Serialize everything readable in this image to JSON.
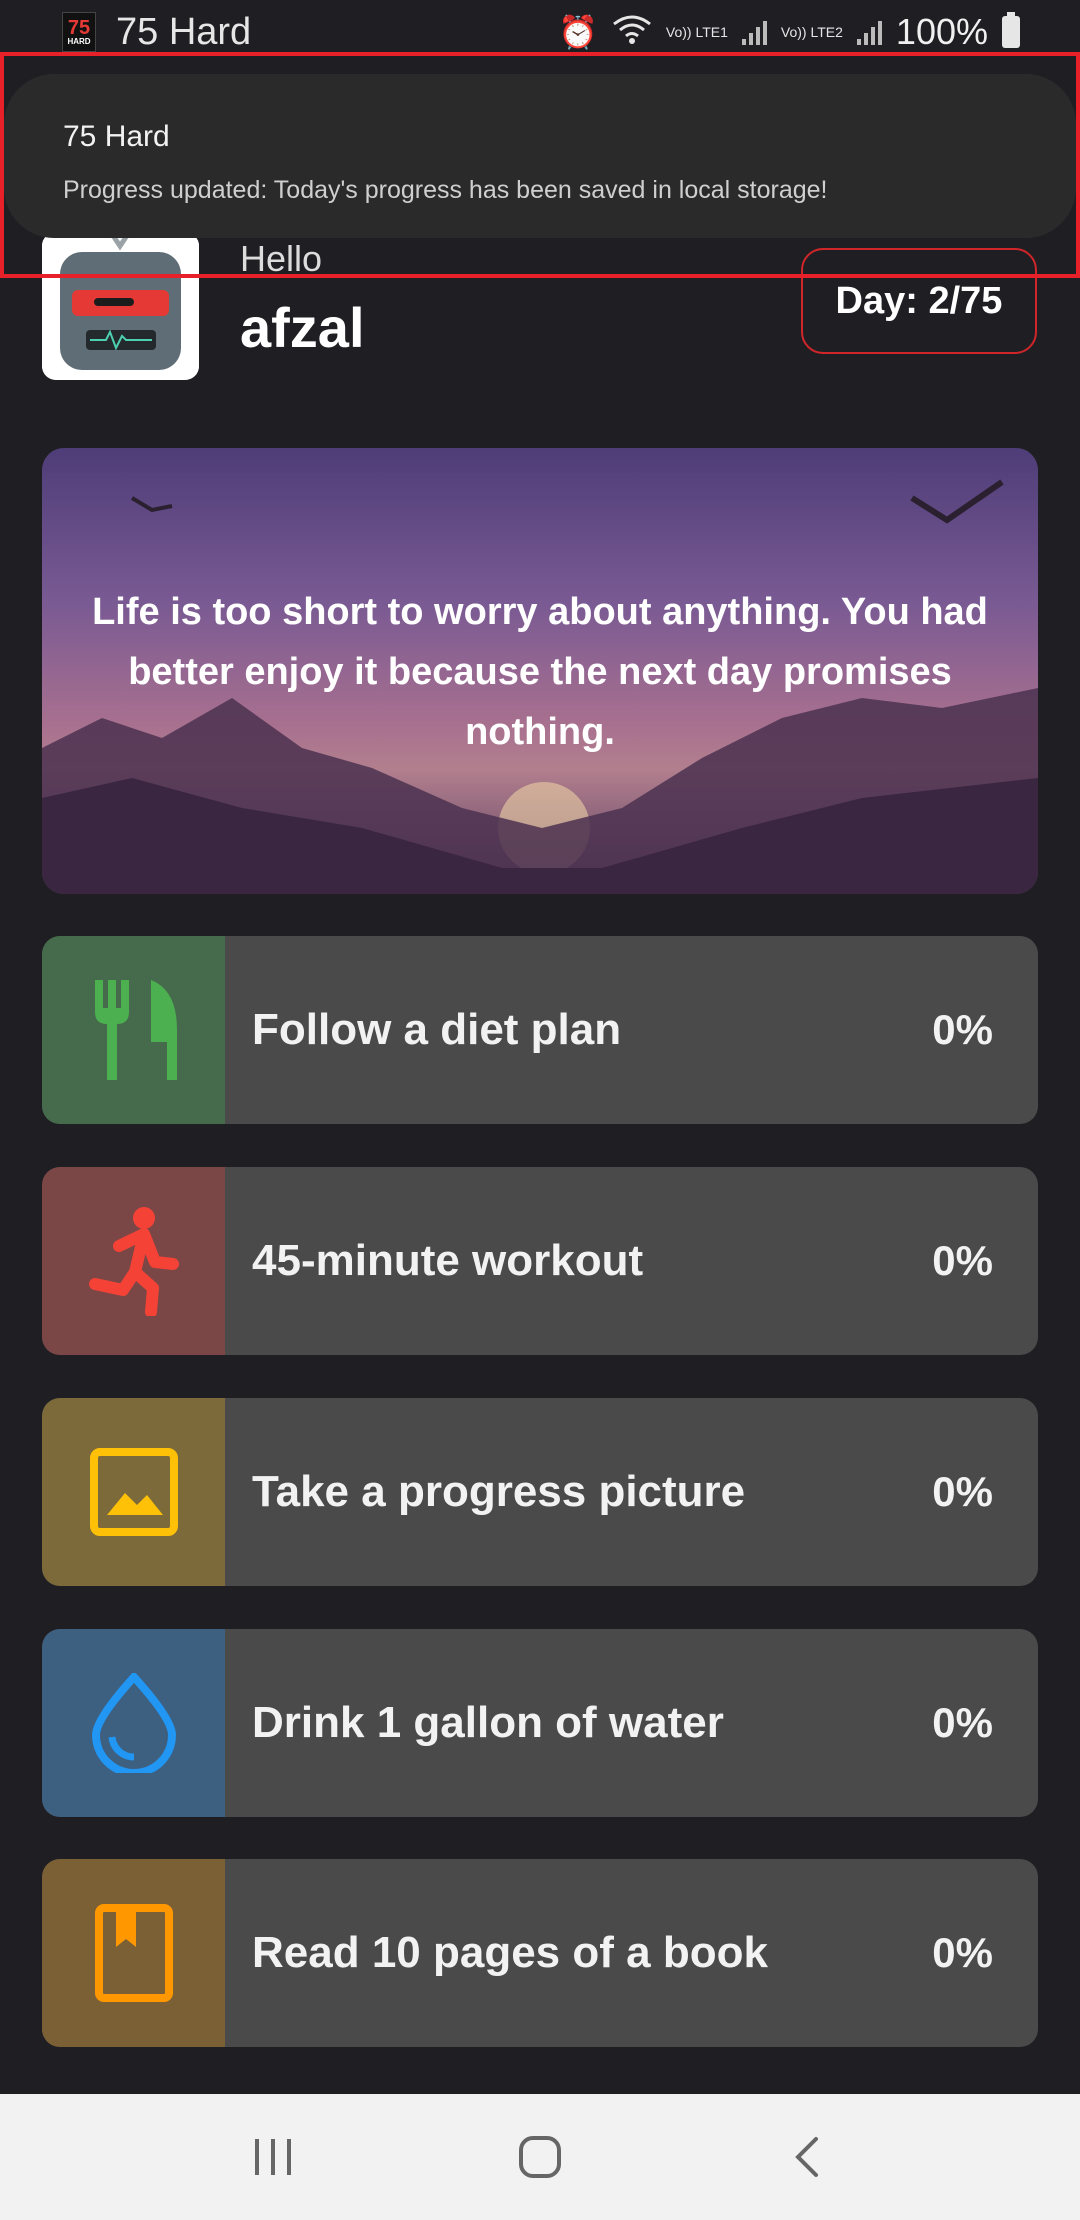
{
  "status_bar": {
    "app_title": "75 Hard",
    "icon_text": "75",
    "icon_sub": "HARD",
    "net1": "Vo)) LTE1",
    "net2": "Vo)) LTE2",
    "battery": "100%"
  },
  "toast": {
    "title": "75 Hard",
    "message": "Progress updated: Today's progress has been saved in local storage!"
  },
  "header": {
    "greeting": "Hello",
    "username": "afzal",
    "day": "Day: 2/75"
  },
  "quote": {
    "text": "Life is too short to worry about anything. You had better enjoy it because the next day promises nothing."
  },
  "tasks": [
    {
      "label": "Follow a diet plan",
      "percent": "0%",
      "icon": "fork-knife-icon",
      "color": "#4cb050",
      "bg": "#466b4c"
    },
    {
      "label": "45-minute workout",
      "percent": "0%",
      "icon": "running-icon",
      "color": "#f44336",
      "bg": "#7b4646"
    },
    {
      "label": "Take a progress picture",
      "percent": "0%",
      "icon": "image-icon",
      "color": "#ffc107",
      "bg": "#7c6a3a"
    },
    {
      "label": "Drink 1 gallon of water",
      "percent": "0%",
      "icon": "water-drop-icon",
      "color": "#2196f3",
      "bg": "#3d5f80"
    },
    {
      "label": "Read 10 pages of a book",
      "percent": "0%",
      "icon": "book-icon",
      "color": "#ff9800",
      "bg": "#7c6035"
    }
  ],
  "colors": {
    "background": "#1f1e23",
    "card": "#4a4a4a",
    "accent_red": "#d0262a"
  }
}
